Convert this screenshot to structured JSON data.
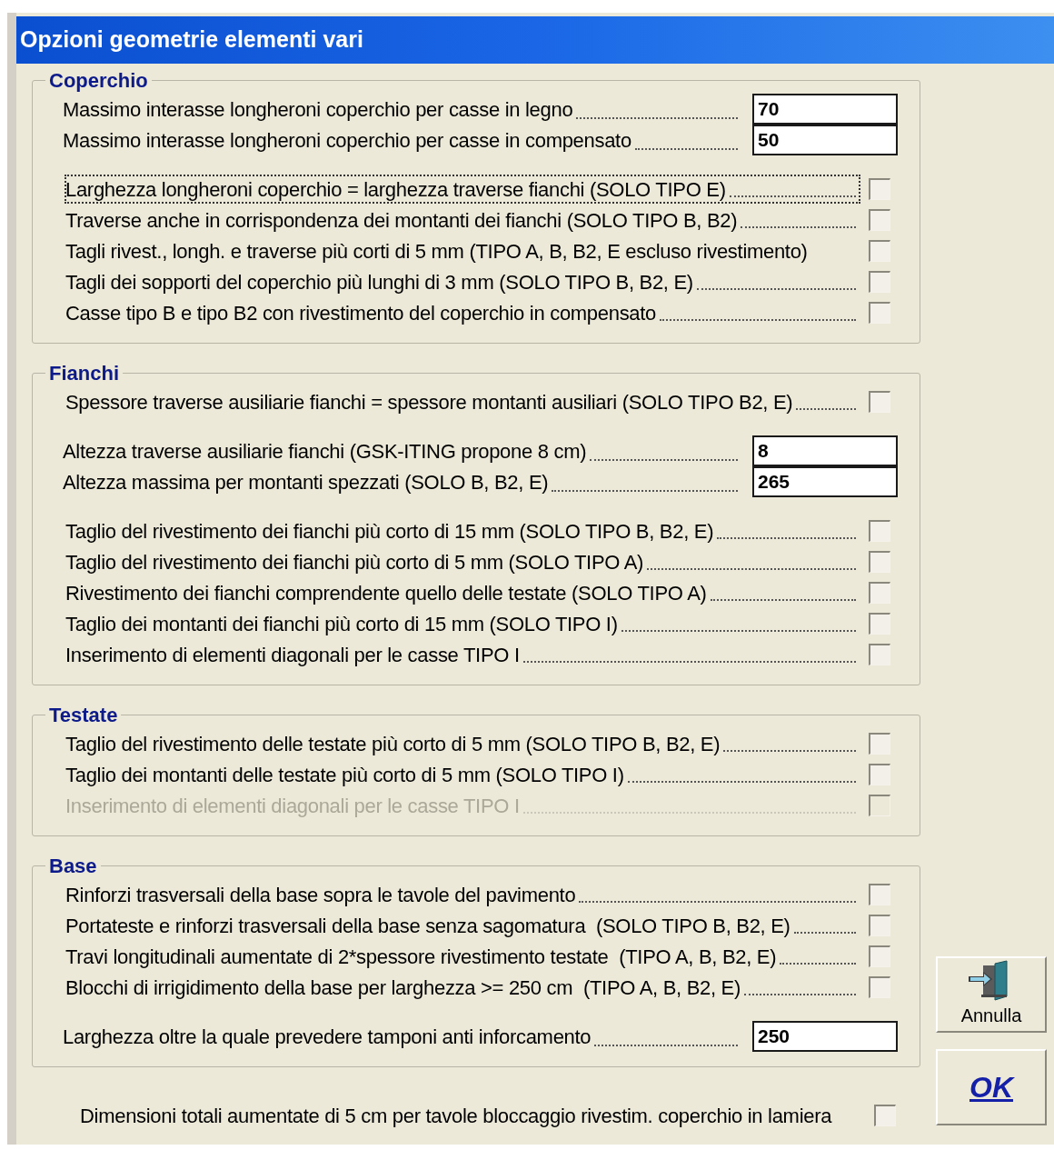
{
  "window": {
    "title": "Opzioni geometrie elementi vari"
  },
  "sections": [
    {
      "title": "Coperchio",
      "items": [
        {
          "kind": "field",
          "label": "Massimo interasse longheroni coperchio per casse in legno",
          "value": "70"
        },
        {
          "kind": "field",
          "label": "Massimo interasse longheroni coperchio per casse in compensato",
          "value": "50"
        },
        {
          "kind": "checkbox",
          "label": "Larghezza longheroni coperchio = larghezza traverse fianchi (SOLO TIPO E)",
          "checked": false,
          "disabled": false,
          "focused": true
        },
        {
          "kind": "checkbox",
          "label": "Traverse anche in corrispondenza dei montanti dei fianchi (SOLO TIPO B, B2)",
          "checked": false,
          "disabled": false,
          "focused": false
        },
        {
          "kind": "checkbox",
          "label": "Tagli rivest., longh. e traverse più corti di 5 mm (TIPO A, B, B2, E escluso rivestimento)",
          "checked": false,
          "disabled": false,
          "focused": false,
          "leader": false
        },
        {
          "kind": "checkbox",
          "label": "Tagli dei sopporti del coperchio più lunghi di 3 mm (SOLO TIPO B, B2, E)",
          "checked": false,
          "disabled": false,
          "focused": false
        },
        {
          "kind": "checkbox",
          "label": "Casse tipo B e tipo B2 con rivestimento del coperchio in compensato",
          "checked": false,
          "disabled": false,
          "focused": false
        }
      ]
    },
    {
      "title": "Fianchi",
      "items": [
        {
          "kind": "checkbox",
          "label": "Spessore traverse ausiliarie fianchi = spessore montanti ausiliari (SOLO TIPO B2, E)",
          "checked": false,
          "disabled": false,
          "focused": false
        },
        {
          "kind": "field",
          "label": "Altezza traverse ausiliarie fianchi (GSK-ITING propone 8 cm)",
          "value": "8"
        },
        {
          "kind": "field",
          "label": "Altezza massima per montanti spezzati (SOLO B, B2, E)",
          "value": "265"
        },
        {
          "kind": "checkbox",
          "label": "Taglio del rivestimento dei fianchi più corto di 15 mm (SOLO TIPO B, B2, E)",
          "checked": false,
          "disabled": false,
          "focused": false
        },
        {
          "kind": "checkbox",
          "label": "Taglio del rivestimento dei fianchi più corto di 5 mm (SOLO TIPO A)",
          "checked": false,
          "disabled": false,
          "focused": false
        },
        {
          "kind": "checkbox",
          "label": "Rivestimento dei fianchi comprendente quello delle testate (SOLO TIPO A)",
          "checked": false,
          "disabled": false,
          "focused": false
        },
        {
          "kind": "checkbox",
          "label": "Taglio dei montanti dei fianchi più corto di 15 mm (SOLO TIPO I)",
          "checked": false,
          "disabled": false,
          "focused": false
        },
        {
          "kind": "checkbox",
          "label": "Inserimento di elementi diagonali per le casse TIPO I",
          "checked": false,
          "disabled": false,
          "focused": false
        }
      ]
    },
    {
      "title": "Testate",
      "items": [
        {
          "kind": "checkbox",
          "label": "Taglio del rivestimento delle testate più corto di 5 mm (SOLO TIPO B, B2, E)",
          "checked": false,
          "disabled": false,
          "focused": false
        },
        {
          "kind": "checkbox",
          "label": "Taglio dei montanti delle testate più corto di 5 mm (SOLO TIPO I)",
          "checked": false,
          "disabled": false,
          "focused": false
        },
        {
          "kind": "checkbox",
          "label": "Inserimento di elementi diagonali per le casse TIPO I",
          "checked": false,
          "disabled": true,
          "focused": false
        }
      ]
    },
    {
      "title": "Base",
      "items": [
        {
          "kind": "checkbox",
          "label": "Rinforzi trasversali della base sopra le tavole del pavimento",
          "checked": false,
          "disabled": false,
          "focused": false
        },
        {
          "kind": "checkbox",
          "label": "Portateste e rinforzi trasversali della base senza sagomatura  (SOLO TIPO B, B2, E)",
          "checked": false,
          "disabled": false,
          "focused": false
        },
        {
          "kind": "checkbox",
          "label": "Travi longitudinali aumentate di 2*spessore rivestimento testate  (TIPO A, B, B2, E)",
          "checked": false,
          "disabled": false,
          "focused": false
        },
        {
          "kind": "checkbox",
          "label": "Blocchi di irrigidimento della base per larghezza >= 250 cm  (TIPO A, B, B2, E)",
          "checked": false,
          "disabled": false,
          "focused": false
        },
        {
          "kind": "field",
          "label": "Larghezza oltre la quale prevedere tamponi anti inforcamento",
          "value": "250"
        }
      ]
    }
  ],
  "footer_option": {
    "label": "Dimensioni totali aumentate di 5 cm per tavole bloccaggio rivestim. coperchio in lamiera",
    "checked": false
  },
  "buttons": [
    {
      "kind": "cancel",
      "label": "Annulla"
    },
    {
      "kind": "ok",
      "label": "OK"
    }
  ]
}
